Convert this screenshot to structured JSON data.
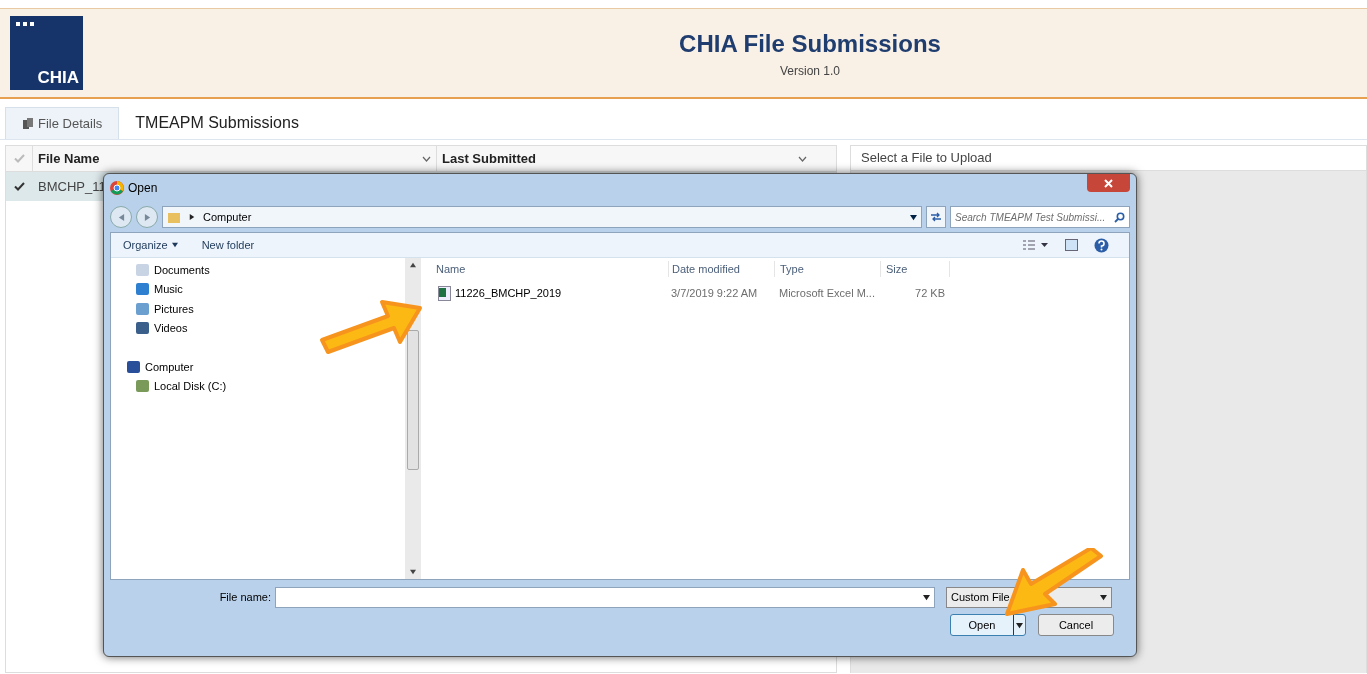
{
  "header": {
    "logo": "CHIA",
    "title": "CHIA File Submissions",
    "version": "Version 1.0"
  },
  "tabs": [
    {
      "label": "File Details",
      "selected": true,
      "kind": "icon"
    },
    {
      "label": "TMEAPM Submissions",
      "selected": false,
      "kind": "plain"
    }
  ],
  "grid": {
    "columns": [
      "File Name",
      "Last Submitted"
    ],
    "rows": [
      {
        "file_name": "BMCHP_11",
        "checked": true,
        "selected": true
      }
    ]
  },
  "upload_panel": {
    "title": "Select a File to Upload"
  },
  "dialog": {
    "title": "Open",
    "address": "Computer",
    "search": {
      "placeholder": "Search TMEAPM Test Submissi..."
    },
    "toolbar": [
      "Organize",
      "New folder"
    ],
    "nav": [
      {
        "label": "Documents",
        "kind": "documents"
      },
      {
        "label": "Music",
        "kind": "music"
      },
      {
        "label": "Pictures",
        "kind": "pictures"
      },
      {
        "label": "Videos",
        "kind": "videos"
      },
      {
        "label": "Computer",
        "kind": "computer",
        "children": [
          {
            "label": "Local Disk (C:)",
            "kind": "disk"
          }
        ]
      }
    ],
    "columns": [
      "Name",
      "Date modified",
      "Type",
      "Size"
    ],
    "files": [
      {
        "name": "11226_BMCHP_2019",
        "date": "3/7/2019 9:22 AM",
        "type": "Microsoft Excel M...",
        "size": "72 KB"
      }
    ],
    "file_name_label": "File name:",
    "filter": "Custom File",
    "buttons": [
      "Open",
      "Cancel"
    ]
  }
}
